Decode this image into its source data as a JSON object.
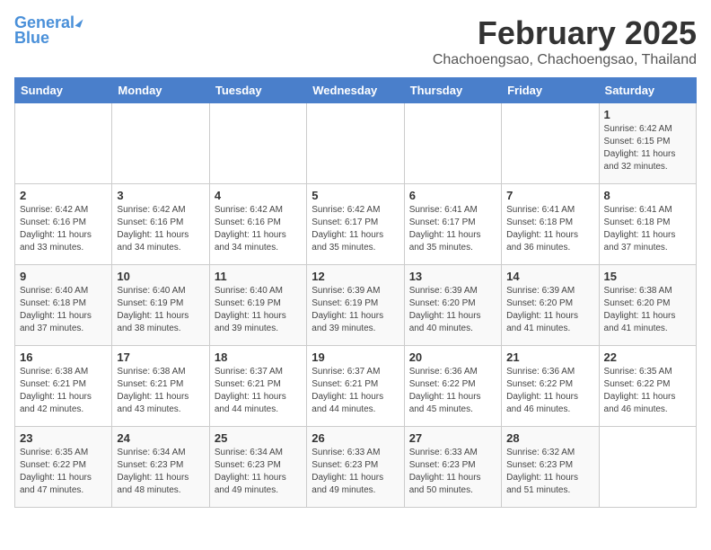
{
  "header": {
    "logo_general": "General",
    "logo_blue": "Blue",
    "month": "February 2025",
    "location": "Chachoengsao, Chachoengsao, Thailand"
  },
  "weekdays": [
    "Sunday",
    "Monday",
    "Tuesday",
    "Wednesday",
    "Thursday",
    "Friday",
    "Saturday"
  ],
  "weeks": [
    [
      {
        "day": "",
        "info": ""
      },
      {
        "day": "",
        "info": ""
      },
      {
        "day": "",
        "info": ""
      },
      {
        "day": "",
        "info": ""
      },
      {
        "day": "",
        "info": ""
      },
      {
        "day": "",
        "info": ""
      },
      {
        "day": "1",
        "info": "Sunrise: 6:42 AM\nSunset: 6:15 PM\nDaylight: 11 hours\nand 32 minutes."
      }
    ],
    [
      {
        "day": "2",
        "info": "Sunrise: 6:42 AM\nSunset: 6:16 PM\nDaylight: 11 hours\nand 33 minutes."
      },
      {
        "day": "3",
        "info": "Sunrise: 6:42 AM\nSunset: 6:16 PM\nDaylight: 11 hours\nand 34 minutes."
      },
      {
        "day": "4",
        "info": "Sunrise: 6:42 AM\nSunset: 6:16 PM\nDaylight: 11 hours\nand 34 minutes."
      },
      {
        "day": "5",
        "info": "Sunrise: 6:42 AM\nSunset: 6:17 PM\nDaylight: 11 hours\nand 35 minutes."
      },
      {
        "day": "6",
        "info": "Sunrise: 6:41 AM\nSunset: 6:17 PM\nDaylight: 11 hours\nand 35 minutes."
      },
      {
        "day": "7",
        "info": "Sunrise: 6:41 AM\nSunset: 6:18 PM\nDaylight: 11 hours\nand 36 minutes."
      },
      {
        "day": "8",
        "info": "Sunrise: 6:41 AM\nSunset: 6:18 PM\nDaylight: 11 hours\nand 37 minutes."
      }
    ],
    [
      {
        "day": "9",
        "info": "Sunrise: 6:40 AM\nSunset: 6:18 PM\nDaylight: 11 hours\nand 37 minutes."
      },
      {
        "day": "10",
        "info": "Sunrise: 6:40 AM\nSunset: 6:19 PM\nDaylight: 11 hours\nand 38 minutes."
      },
      {
        "day": "11",
        "info": "Sunrise: 6:40 AM\nSunset: 6:19 PM\nDaylight: 11 hours\nand 39 minutes."
      },
      {
        "day": "12",
        "info": "Sunrise: 6:39 AM\nSunset: 6:19 PM\nDaylight: 11 hours\nand 39 minutes."
      },
      {
        "day": "13",
        "info": "Sunrise: 6:39 AM\nSunset: 6:20 PM\nDaylight: 11 hours\nand 40 minutes."
      },
      {
        "day": "14",
        "info": "Sunrise: 6:39 AM\nSunset: 6:20 PM\nDaylight: 11 hours\nand 41 minutes."
      },
      {
        "day": "15",
        "info": "Sunrise: 6:38 AM\nSunset: 6:20 PM\nDaylight: 11 hours\nand 41 minutes."
      }
    ],
    [
      {
        "day": "16",
        "info": "Sunrise: 6:38 AM\nSunset: 6:21 PM\nDaylight: 11 hours\nand 42 minutes."
      },
      {
        "day": "17",
        "info": "Sunrise: 6:38 AM\nSunset: 6:21 PM\nDaylight: 11 hours\nand 43 minutes."
      },
      {
        "day": "18",
        "info": "Sunrise: 6:37 AM\nSunset: 6:21 PM\nDaylight: 11 hours\nand 44 minutes."
      },
      {
        "day": "19",
        "info": "Sunrise: 6:37 AM\nSunset: 6:21 PM\nDaylight: 11 hours\nand 44 minutes."
      },
      {
        "day": "20",
        "info": "Sunrise: 6:36 AM\nSunset: 6:22 PM\nDaylight: 11 hours\nand 45 minutes."
      },
      {
        "day": "21",
        "info": "Sunrise: 6:36 AM\nSunset: 6:22 PM\nDaylight: 11 hours\nand 46 minutes."
      },
      {
        "day": "22",
        "info": "Sunrise: 6:35 AM\nSunset: 6:22 PM\nDaylight: 11 hours\nand 46 minutes."
      }
    ],
    [
      {
        "day": "23",
        "info": "Sunrise: 6:35 AM\nSunset: 6:22 PM\nDaylight: 11 hours\nand 47 minutes."
      },
      {
        "day": "24",
        "info": "Sunrise: 6:34 AM\nSunset: 6:23 PM\nDaylight: 11 hours\nand 48 minutes."
      },
      {
        "day": "25",
        "info": "Sunrise: 6:34 AM\nSunset: 6:23 PM\nDaylight: 11 hours\nand 49 minutes."
      },
      {
        "day": "26",
        "info": "Sunrise: 6:33 AM\nSunset: 6:23 PM\nDaylight: 11 hours\nand 49 minutes."
      },
      {
        "day": "27",
        "info": "Sunrise: 6:33 AM\nSunset: 6:23 PM\nDaylight: 11 hours\nand 50 minutes."
      },
      {
        "day": "28",
        "info": "Sunrise: 6:32 AM\nSunset: 6:23 PM\nDaylight: 11 hours\nand 51 minutes."
      },
      {
        "day": "",
        "info": ""
      }
    ]
  ]
}
